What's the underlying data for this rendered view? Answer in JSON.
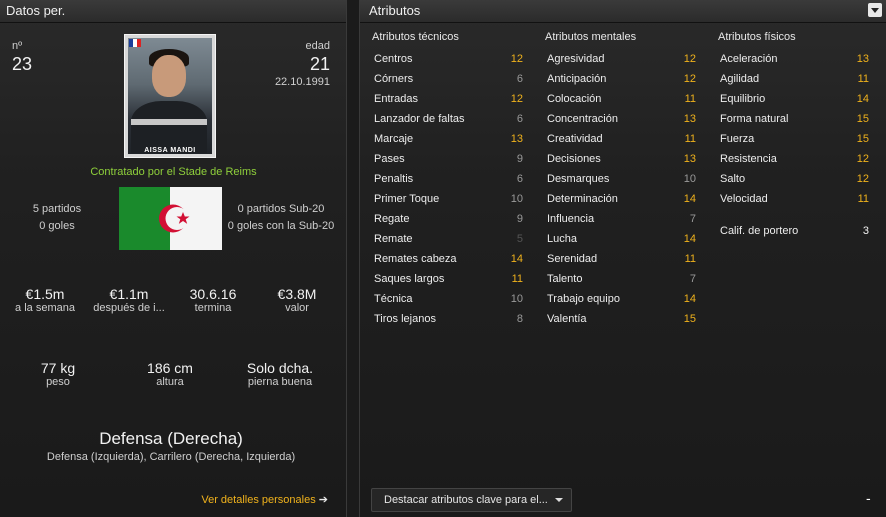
{
  "left": {
    "title": "Datos per.",
    "number_label": "nº",
    "number": "23",
    "age_label": "edad",
    "age": "21",
    "dob": "22.10.1991",
    "photo_name": "AISSA MANDI",
    "contracted": "Contratado por el Stade de Reims",
    "matches": "5 partidos",
    "goals": "0 goles",
    "u20_matches": "0 partidos Sub-20",
    "u20_goals": "0 goles con la Sub-20",
    "contract": [
      {
        "value": "€1.5m",
        "label": "a la semana"
      },
      {
        "value": "€1.1m",
        "label": "después de i..."
      },
      {
        "value": "30.6.16",
        "label": "termina"
      },
      {
        "value": "€3.8M",
        "label": "valor"
      }
    ],
    "physical": [
      {
        "value": "77 kg",
        "label": "peso"
      },
      {
        "value": "186 cm",
        "label": "altura"
      },
      {
        "value": "Solo dcha.",
        "label": "pierna buena"
      }
    ],
    "position": "Defensa (Derecha)",
    "positions_other": "Defensa (Izquierda), Carrilero (Derecha, Izquierda)",
    "details_link": "Ver detalles personales",
    "details_arrow": "➔"
  },
  "right": {
    "title": "Atributos",
    "technical_title": "Atributos técnicos",
    "mental_title": "Atributos mentales",
    "physical_title": "Atributos físicos",
    "technical": [
      {
        "name": "Centros",
        "value": "12"
      },
      {
        "name": "Córners",
        "value": "6"
      },
      {
        "name": "Entradas",
        "value": "12"
      },
      {
        "name": "Lanzador de faltas",
        "value": "6"
      },
      {
        "name": "Marcaje",
        "value": "13"
      },
      {
        "name": "Pases",
        "value": "9"
      },
      {
        "name": "Penaltis",
        "value": "6"
      },
      {
        "name": "Primer Toque",
        "value": "10"
      },
      {
        "name": "Regate",
        "value": "9"
      },
      {
        "name": "Remate",
        "value": "5"
      },
      {
        "name": "Remates cabeza",
        "value": "14"
      },
      {
        "name": "Saques largos",
        "value": "11"
      },
      {
        "name": "Técnica",
        "value": "10"
      },
      {
        "name": "Tiros lejanos",
        "value": "8"
      }
    ],
    "mental": [
      {
        "name": "Agresividad",
        "value": "12"
      },
      {
        "name": "Anticipación",
        "value": "12"
      },
      {
        "name": "Colocación",
        "value": "11"
      },
      {
        "name": "Concentración",
        "value": "13"
      },
      {
        "name": "Creatividad",
        "value": "11"
      },
      {
        "name": "Decisiones",
        "value": "13"
      },
      {
        "name": "Desmarques",
        "value": "10"
      },
      {
        "name": "Determinación",
        "value": "14"
      },
      {
        "name": "Influencia",
        "value": "7"
      },
      {
        "name": "Lucha",
        "value": "14"
      },
      {
        "name": "Serenidad",
        "value": "11"
      },
      {
        "name": "Talento",
        "value": "7"
      },
      {
        "name": "Trabajo equipo",
        "value": "14"
      },
      {
        "name": "Valentía",
        "value": "15"
      }
    ],
    "physical": [
      {
        "name": "Aceleración",
        "value": "13"
      },
      {
        "name": "Agilidad",
        "value": "11"
      },
      {
        "name": "Equilibrio",
        "value": "14"
      },
      {
        "name": "Forma natural",
        "value": "15"
      },
      {
        "name": "Fuerza",
        "value": "15"
      },
      {
        "name": "Resistencia",
        "value": "12"
      },
      {
        "name": "Salto",
        "value": "12"
      },
      {
        "name": "Velocidad",
        "value": "11"
      }
    ],
    "goalkeeper_label": "Calif. de portero",
    "goalkeeper_value": "3",
    "highlight_button": "Destacar atributos clave para el...",
    "collapse": "-"
  },
  "colors": {
    "highlight": "#f0b21c",
    "contracted": "#8fd03b",
    "flag_green": "#1a8a2c",
    "flag_red": "#d21034"
  }
}
